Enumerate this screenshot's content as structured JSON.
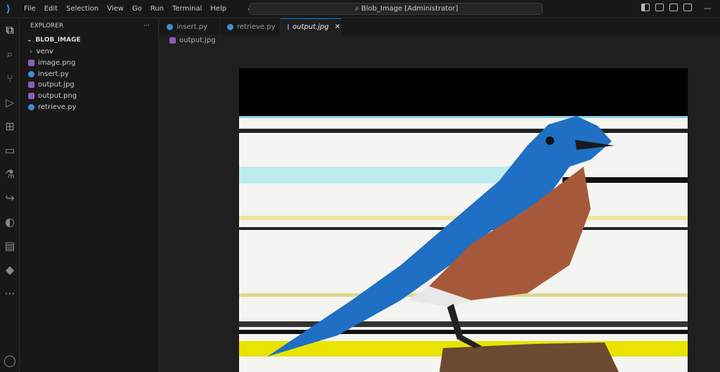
{
  "menu": [
    "File",
    "Edit",
    "Selection",
    "View",
    "Go",
    "Run",
    "Terminal",
    "Help"
  ],
  "search": {
    "text": "Blob_Image [Administrator]"
  },
  "explorer": {
    "title": "EXPLORER",
    "more": "···",
    "root": "BLOB_IMAGE",
    "items": [
      {
        "name": "venv",
        "type": "folder"
      },
      {
        "name": "image.png",
        "type": "image"
      },
      {
        "name": "insert.py",
        "type": "python"
      },
      {
        "name": "output.jpg",
        "type": "image"
      },
      {
        "name": "output.png",
        "type": "image"
      },
      {
        "name": "retrieve.py",
        "type": "python"
      }
    ]
  },
  "tabs": [
    {
      "label": "insert.py",
      "type": "python"
    },
    {
      "label": "retrieve.py",
      "type": "python"
    },
    {
      "label": "output.jpg",
      "type": "image",
      "active": true
    }
  ],
  "breadcrumb": "output.jpg",
  "colors": {
    "accent": "#0078d4",
    "python": "#3d8fd1",
    "image": "#8a5fb8"
  }
}
